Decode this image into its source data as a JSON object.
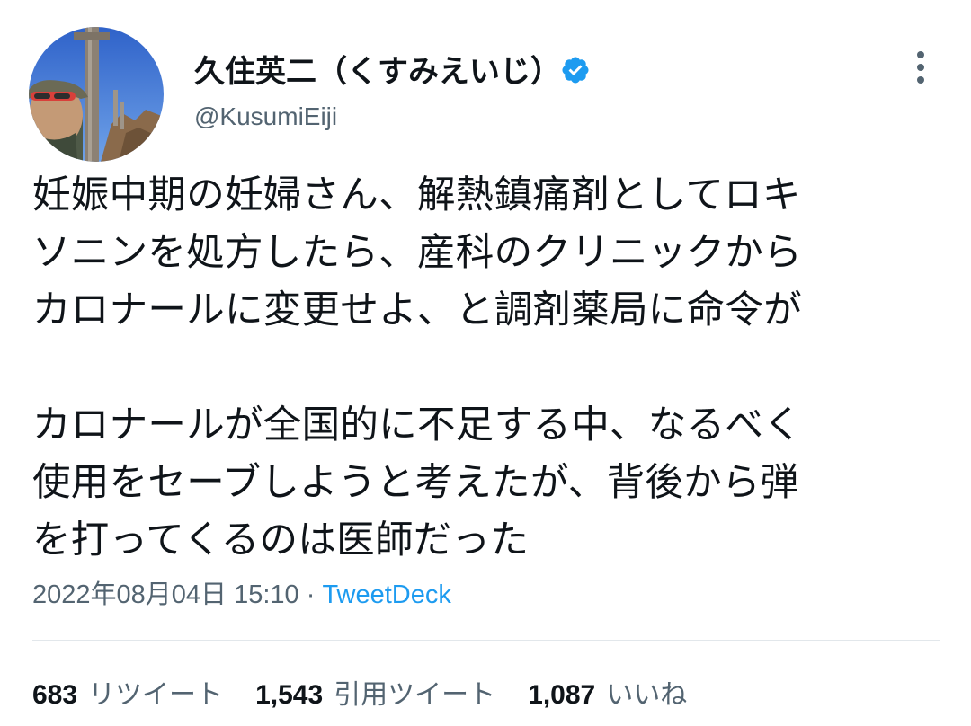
{
  "author": {
    "display_name": "久住英二（くすみえいじ）",
    "handle": "@KusumiEiji",
    "verified": true,
    "avatar_icon": "profile-photo"
  },
  "tweet": {
    "text": "妊娠中期の妊婦さん、解熱鎮痛剤としてロキ\nソニンを処方したら、産科のクリニックから\nカロナールに変更せよ、と調剤薬局に命令が\n\nカロナールが全国的に不足する中、なるべく\n使用をセーブしようと考えたが、背後から弾\nを打ってくるのは医師だった"
  },
  "meta": {
    "timestamp": "2022年08月04日 15:10",
    "separator": " · ",
    "source": "TweetDeck"
  },
  "stats": {
    "retweets": {
      "count": "683",
      "label": "リツイート"
    },
    "quotes": {
      "count": "1,543",
      "label": "引用ツイート"
    },
    "likes": {
      "count": "1,087",
      "label": "いいね"
    }
  },
  "colors": {
    "text": "#0f1419",
    "secondary": "#536471",
    "accent": "#1d9bf0",
    "divider": "#e2e7eb"
  }
}
